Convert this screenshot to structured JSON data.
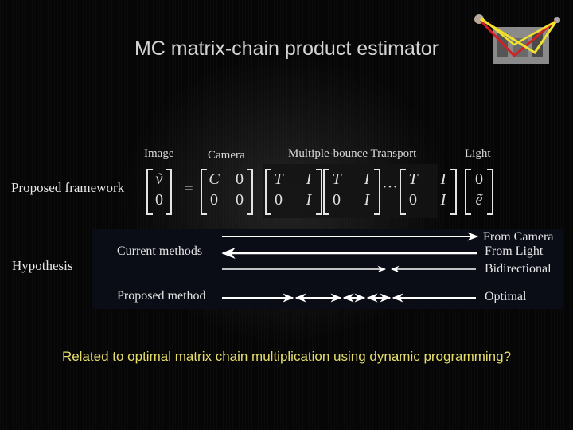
{
  "slide": {
    "title": "MC matrix-chain product estimator",
    "thumbnail_icon": "light-path-thumbnail-icon",
    "colors": {
      "background": "#060606",
      "title": "#d4d4d4",
      "question": "#e6dd6a",
      "panel": "#0a0c16",
      "path_red": "#d42020",
      "path_yellow": "#f0e030"
    },
    "framework": {
      "row_label": "Proposed framework",
      "headers": {
        "image": "Image",
        "camera": "Camera",
        "transport": "Multiple-bounce Transport",
        "light": "Light"
      },
      "image_vector": [
        "ṽ",
        "0"
      ],
      "equals": "=",
      "camera_matrix": [
        [
          "C",
          "0"
        ],
        [
          "0",
          "0"
        ]
      ],
      "transport_matrix": [
        [
          "T",
          "I"
        ],
        [
          "0",
          "I"
        ]
      ],
      "ellipsis": "···",
      "light_vector": [
        "0",
        "ẽ"
      ]
    },
    "hypothesis": {
      "row_label": "Hypothesis",
      "current_label": "Current methods",
      "proposed_label": "Proposed method",
      "strategies": [
        {
          "name": "From Camera"
        },
        {
          "name": "From Light"
        },
        {
          "name": "Bidirectional"
        },
        {
          "name": "Optimal"
        }
      ]
    },
    "question": "Related to optimal matrix chain multiplication using dynamic programming?"
  }
}
